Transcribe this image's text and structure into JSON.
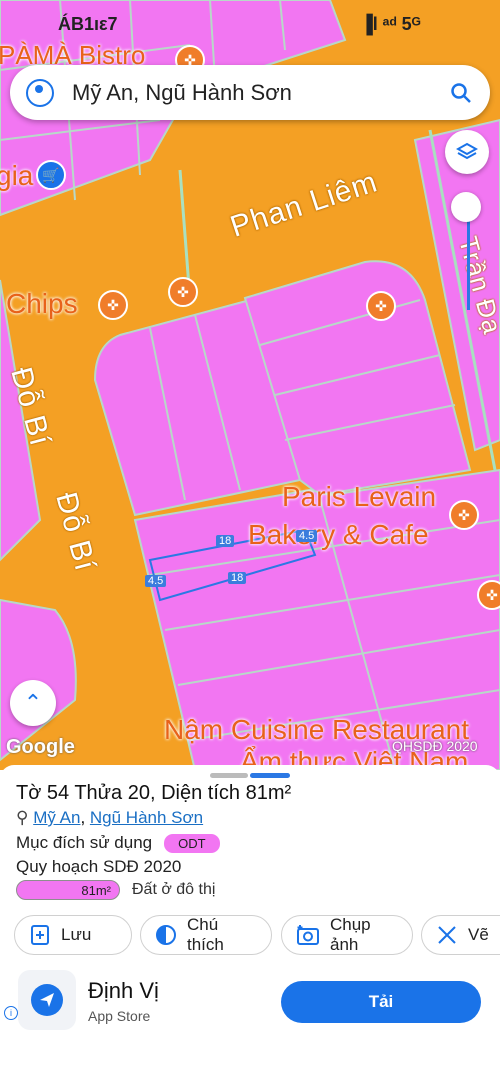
{
  "status_bar": {
    "left_text": "ÁΒ1ıε7",
    "right_text": "▐l ᵃᵈ 5ᴳ"
  },
  "search": {
    "query": "Mỹ An, Ngũ Hành Sơn"
  },
  "map": {
    "streets": [
      "Phan Liêm",
      "Đỗ Bí",
      "Đỗ Bí",
      "Trần Đạ"
    ],
    "pois": [
      "PÀMÀ Bistro",
      "gia",
      "Chips",
      "Paris Levain",
      "Bakery & Cafe",
      "Nậm Cuisine Restaurant",
      "Ẩm thực Việt Nam"
    ],
    "measurements": [
      "18",
      "4.5",
      "4.5",
      "18"
    ],
    "attribution": "Google",
    "layer_tag": "QHSDĐ 2020",
    "icons": [
      "restaurant-icon",
      "shopping-icon",
      "layers-icon",
      "chevron-up-icon"
    ]
  },
  "sheet": {
    "title": "Tờ 54 Thửa 20, Diện tích 81m²",
    "ward": "Mỹ An",
    "separator": ", ",
    "district": "Ngũ Hành Sơn",
    "purpose_label": "Mục đích sử dụng",
    "purpose_code": "ODT",
    "plan_label": "Quy hoạch SDĐ 2020",
    "plan_area": "81m²",
    "plan_desc": "Đất ở đô thị",
    "land_color": "#f276f2",
    "actions": [
      "Lưu",
      "Chú thích",
      "Chụp ảnh",
      "Vẽ"
    ]
  },
  "ad": {
    "app_name": "Định Vị",
    "store": "App Store",
    "button": "Tải",
    "info": "i"
  },
  "colors": {
    "road": "#f4a024",
    "parcel": "#f276f2",
    "accent": "#1a73e8"
  }
}
